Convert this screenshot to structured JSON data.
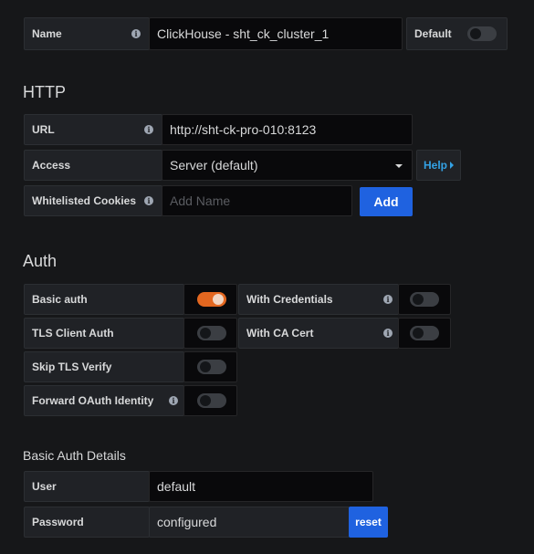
{
  "name_row": {
    "label": "Name",
    "value": "ClickHouse - sht_ck_cluster_1",
    "default_label": "Default",
    "default_on": false
  },
  "http": {
    "title": "HTTP",
    "url_label": "URL",
    "url_value": "http://sht-ck-pro-010:8123",
    "access_label": "Access",
    "access_value": "Server (default)",
    "help_label": "Help",
    "cookies_label": "Whitelisted Cookies",
    "cookies_placeholder": "Add Name",
    "add_label": "Add"
  },
  "auth": {
    "title": "Auth",
    "basic_auth_label": "Basic auth",
    "basic_auth_on": true,
    "with_credentials_label": "With Credentials",
    "with_credentials_on": false,
    "tls_client_label": "TLS Client Auth",
    "tls_client_on": false,
    "with_ca_label": "With CA Cert",
    "with_ca_on": false,
    "skip_tls_label": "Skip TLS Verify",
    "skip_tls_on": false,
    "forward_oauth_label": "Forward OAuth Identity",
    "forward_oauth_on": false
  },
  "basic_auth_details": {
    "title": "Basic Auth Details",
    "user_label": "User",
    "user_value": "default",
    "password_label": "Password",
    "password_value": "configured",
    "reset_label": "reset"
  },
  "colors": {
    "accent_orange": "#e36720",
    "primary_blue": "#1f62e0",
    "link_blue": "#33a2e5"
  },
  "icons": {
    "info": "info-icon",
    "dropdown": "chevron-down-icon",
    "help_caret": "caret-right-icon"
  }
}
